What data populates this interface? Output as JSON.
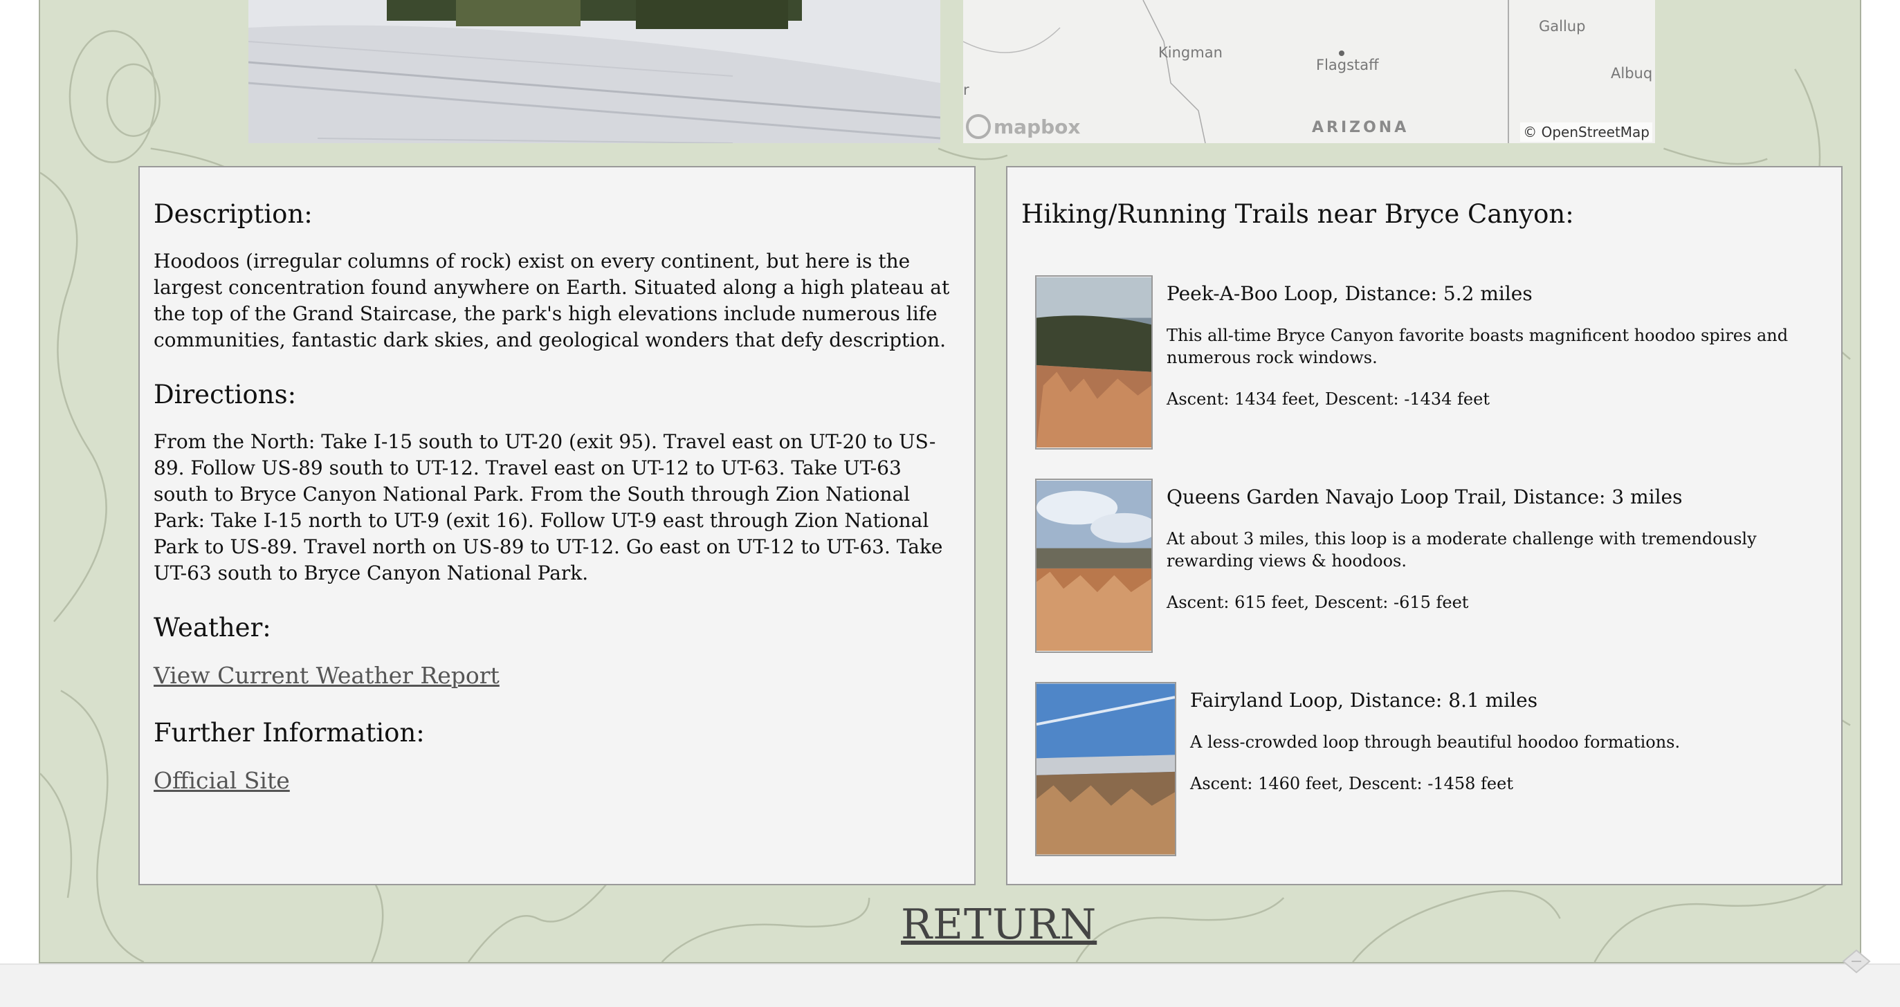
{
  "map": {
    "labels": [
      "Gallup",
      "Kingman",
      "Flagstaff",
      "Albuq",
      "r"
    ],
    "state": "ARIZONA",
    "logo": "mapbox",
    "attribution": "© OpenStreetMap"
  },
  "details": {
    "description_heading": "Description:",
    "description_text": "Hoodoos (irregular columns of rock) exist on every continent, but here is the largest concentration found anywhere on Earth. Situated along a high plateau at the top of the Grand Staircase, the park's high elevations include numerous life communities, fantastic dark skies, and geological wonders that defy description.",
    "directions_heading": "Directions:",
    "directions_text": "From the North: Take I-15 south to UT-20 (exit 95). Travel east on UT-20 to US-89. Follow US-89 south to UT-12. Travel east on UT-12 to UT-63. Take UT-63 south to Bryce Canyon National Park. From the South through Zion National Park: Take I-15 north to UT-9 (exit 16). Follow UT-9 east through Zion National Park to US-89. Travel north on US-89 to UT-12. Go east on UT-12 to UT-63. Take UT-63 south to Bryce Canyon National Park.",
    "weather_heading": "Weather:",
    "weather_link": "View Current Weather Report",
    "further_heading": "Further Information:",
    "official_link": "Official Site"
  },
  "trails": {
    "heading": "Hiking/Running Trails near Bryce Canyon:",
    "items": [
      {
        "title": "Peek-A-Boo Loop, Distance: 5.2 miles",
        "desc": "This all-time Bryce Canyon favorite boasts magnificent hoodoo spires and numerous rock windows.",
        "stats": "Ascent: 1434 feet, Descent: -1434 feet"
      },
      {
        "title": "Queens Garden Navajo Loop Trail, Distance: 3 miles",
        "desc": "At about 3 miles, this loop is a moderate challenge with tremendously rewarding views & hoodoos.",
        "stats": "Ascent: 615 feet, Descent: -615 feet"
      },
      {
        "title": "Fairyland Loop, Distance: 8.1 miles",
        "desc": "A less-crowded loop through beautiful hoodoo formations.",
        "stats": "Ascent: 1460 feet, Descent: -1458 feet"
      }
    ]
  },
  "return_label": "RETURN",
  "colors": {
    "background": "#d8e0cc",
    "panel": "#f4f4f4",
    "link": "#555555"
  }
}
